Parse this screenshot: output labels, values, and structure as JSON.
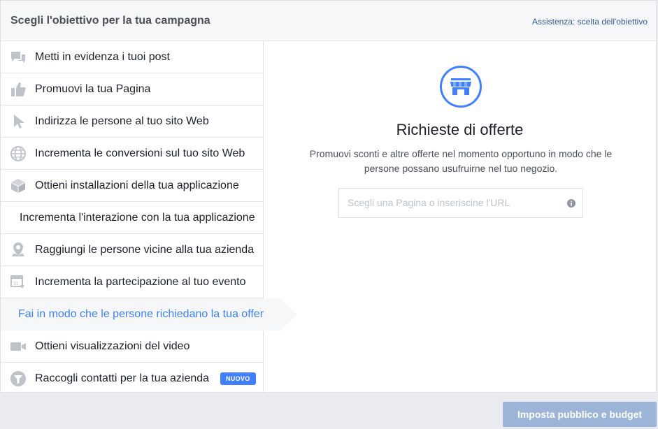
{
  "header": {
    "title": "Scegli l'obiettivo per la tua campagna",
    "help_link": "Assistenza: scelta dell'obiettivo"
  },
  "sidebar": {
    "items": [
      {
        "label": "Metti in evidenza i tuoi post",
        "icon": "speech-bubbles-icon"
      },
      {
        "label": "Promuovi la tua Pagina",
        "icon": "thumbs-up-icon"
      },
      {
        "label": "Indirizza le persone al tuo sito Web",
        "icon": "cursor-icon"
      },
      {
        "label": "Incrementa le conversioni sul tuo sito Web",
        "icon": "globe-icon"
      },
      {
        "label": "Ottieni installazioni della tua applicazione",
        "icon": "box-icon"
      },
      {
        "label": "Incrementa l'interazione con la tua applicazione",
        "icon": ""
      },
      {
        "label": "Raggiungi le persone vicine alla tua azienda",
        "icon": "map-pin-icon"
      },
      {
        "label": "Incrementa la partecipazione al tuo evento",
        "icon": "calendar-icon"
      },
      {
        "label": "Fai in modo che le persone richiedano la tua offer",
        "icon": "",
        "active": true
      },
      {
        "label": "Ottieni visualizzazioni del video",
        "icon": "video-camera-icon"
      },
      {
        "label": "Raccogli contatti per la tua azienda",
        "icon": "funnel-icon",
        "badge": "NUOVO"
      }
    ]
  },
  "main": {
    "icon": "store-icon",
    "title": "Richieste di offerte",
    "description": "Promuovi sconti e altre offerte nel momento opportuno in modo che le persone possano usufruirne nel tuo negozio.",
    "input_placeholder": "Scegli una Pagina o inseriscine l'URL",
    "input_value": ""
  },
  "footer": {
    "button_label": "Imposta pubblico e budget"
  },
  "colors": {
    "accent": "#4080ff",
    "icon_gray": "#bec3c9",
    "button_disabled": "#9cb4d8"
  }
}
